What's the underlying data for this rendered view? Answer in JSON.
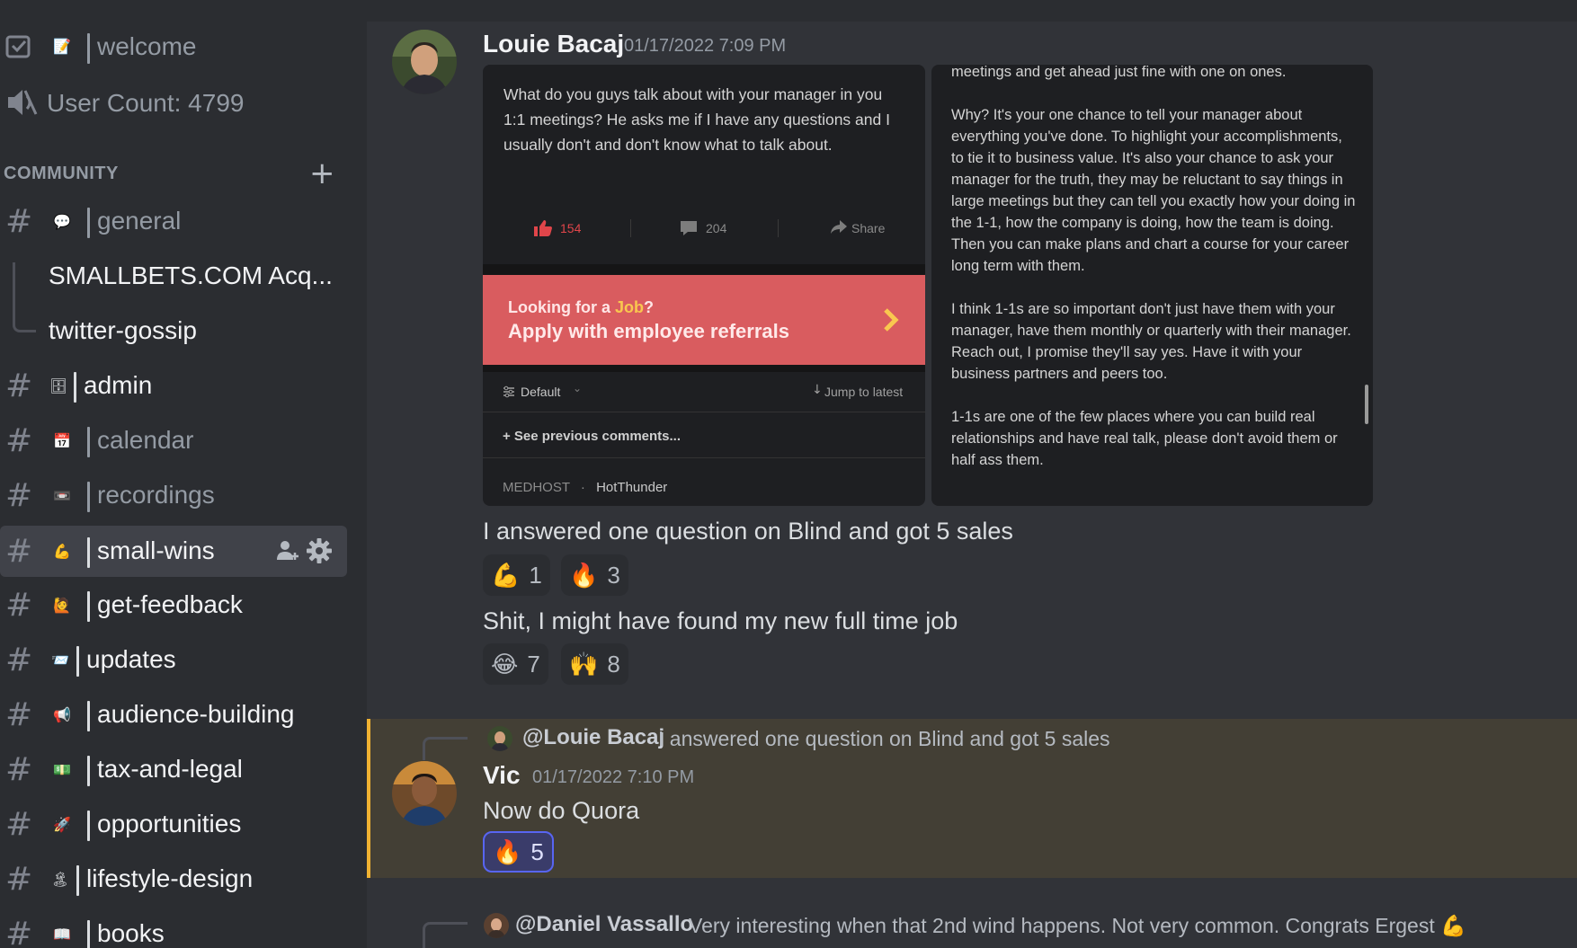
{
  "sidebar": {
    "top_items": [
      {
        "label": "welcome",
        "icon": "rules-icon",
        "emoji": "📝"
      },
      {
        "label": "User Count: 4799",
        "icon": "speaker-muted-icon"
      }
    ],
    "category": "COMMUNITY",
    "channels": [
      {
        "label": "general",
        "emoji": "💬"
      },
      {
        "label": "SMALLBETS.COM Acq...",
        "thread": true
      },
      {
        "label": "twitter-gossip",
        "thread": true
      },
      {
        "label": "admin",
        "emoji": "🗄"
      },
      {
        "label": "calendar",
        "emoji": "📅"
      },
      {
        "label": "recordings",
        "emoji": "📼"
      },
      {
        "label": "small-wins",
        "emoji": "💪"
      },
      {
        "label": "get-feedback",
        "emoji": "🙋"
      },
      {
        "label": "updates",
        "emoji": "📨"
      },
      {
        "label": "audience-building",
        "emoji": "📢"
      },
      {
        "label": "tax-and-legal",
        "emoji": "💵"
      },
      {
        "label": "opportunities",
        "emoji": "🚀"
      },
      {
        "label": "lifestyle-design",
        "emoji": "🏝"
      },
      {
        "label": "books",
        "emoji": "📖"
      }
    ]
  },
  "messages": {
    "m1": {
      "author": "Louie Bacaj",
      "timestamp": "01/17/2022 7:09 PM",
      "embed_left": {
        "question": "What do you guys talk about with your manager in you 1:1 meetings? He asks me if I have any questions and I usually don't and don't know what to talk about.",
        "likes": "154",
        "comments": "204",
        "share": "Share",
        "banner_line1_a": "Looking for a ",
        "banner_line1_b": "Job",
        "banner_line1_c": "?",
        "banner_line2": "Apply with employee referrals",
        "sort": "Default",
        "jump": "Jump to latest",
        "see_prev": "+ See previous comments...",
        "company": "MEDHOST",
        "user": "HotThunder"
      },
      "embed_right": {
        "p0": "meetings and get ahead just fine with one on ones.",
        "p1": "Why? It's your one chance to tell your manager about everything you've done. To highlight your accomplishments, to tie it to business value.  It's also your chance to ask your manager for the truth, they may be reluctant to say things in large meetings but they can tell you exactly how your doing in the 1-1, how the company is doing, how the team is doing. Then you can make plans and chart a course for your career long term with them.",
        "p2": "I think 1-1s are so important don't just have them with your manager, have them monthly or quarterly with their manager. Reach out, I promise they'll say yes. Have it with your business partners and peers too.",
        "p3": "1-1s are one of the few places where you can build real relationships and have real talk, please don't avoid them or half ass them."
      }
    },
    "m2": {
      "text": "I answered one question on Blind and got 5 sales",
      "r1_emoji": "💪",
      "r1_count": "1",
      "r2_emoji": "🔥",
      "r2_count": "3"
    },
    "m3": {
      "text": "Shit, I might have found my new full time job",
      "r1_emoji": "😂",
      "r1_count": "7",
      "r2_emoji": "🙌",
      "r2_count": "8"
    },
    "m4": {
      "reply_to": "@Louie Bacaj",
      "reply_text": "I answered one question on Blind and got 5 sales",
      "author": "Vic",
      "timestamp": "01/17/2022 7:10 PM",
      "text": "Now do Quora",
      "r1_emoji": "🔥",
      "r1_count": "5"
    },
    "m5": {
      "reply_to": "@Daniel Vassallo",
      "reply_text": "Very interesting when that 2nd wind happens. Not very common. Congrats Ergest",
      "reply_emoji": "💪"
    }
  }
}
